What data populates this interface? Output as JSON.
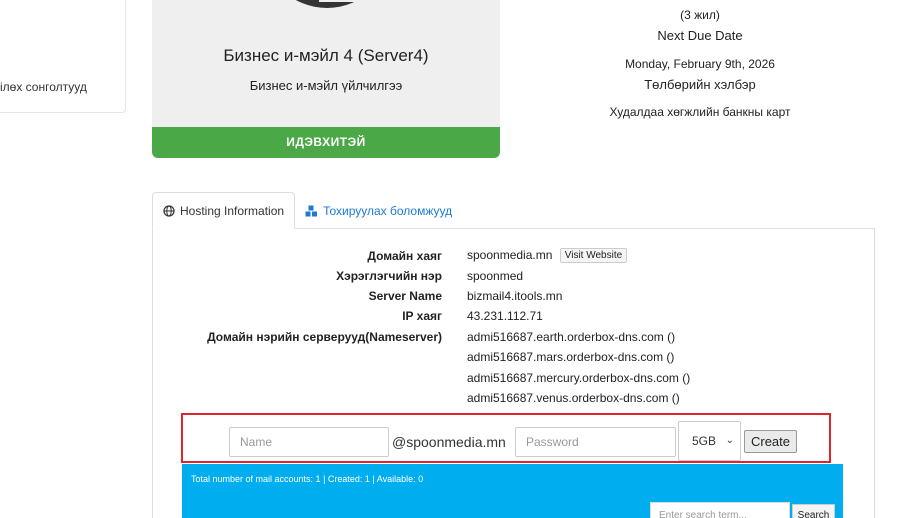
{
  "sidebar": {
    "link_label": "ілөх сонголтууд"
  },
  "product": {
    "title": "Бизнес и-мэйл 4 (Server4)",
    "subtitle": "Бизнес и-мэйл үйлчилгээ",
    "status": "ИДЭВХИТЭЙ",
    "status_color": "#4ba846"
  },
  "billing": {
    "period": "(3 жил)",
    "next_due_label": "Next Due Date",
    "next_due_date": "Monday, February 9th, 2026",
    "payment_label": "Төлбөрийн хэлбэр",
    "payment_method": "Худалдаа хөгжлийн банкны карт"
  },
  "tabs": [
    {
      "label": "Hosting Information",
      "icon": "globe-icon",
      "active": true
    },
    {
      "label": "Тохируулах боломжууд",
      "icon": "cubes-icon",
      "active": false
    }
  ],
  "hosting": {
    "domain_label": "Домайн хаяг",
    "domain_value": "spoonmedia.mn",
    "visit_label": "Visit Website",
    "username_label": "Хэрэглэгчийн нэр",
    "username_value": "spoonmed",
    "server_label": "Server Name",
    "server_value": "bizmail4.itools.mn",
    "ip_label": "IP хаяг",
    "ip_value": "43.231.112.71",
    "ns_label": "Домайн нэрийн серверууд(Nameserver)",
    "nameservers": [
      "admi516687.earth.orderbox-dns.com ()",
      "admi516687.mars.orderbox-dns.com ()",
      "admi516687.mercury.orderbox-dns.com ()",
      "admi516687.venus.orderbox-dns.com ()"
    ]
  },
  "create_form": {
    "name_placeholder": "Name",
    "domain_suffix": "@spoonmedia.mn",
    "password_placeholder": "Password",
    "quota_selected": "5GB",
    "create_label": "Create",
    "highlight_color": "#e0242b"
  },
  "summary": {
    "text": "Total number of mail accounts: 1 | Created: 1 | Available: 0",
    "search_placeholder": "Enter search term...",
    "search_label": "Search",
    "color": "#00aef0"
  }
}
